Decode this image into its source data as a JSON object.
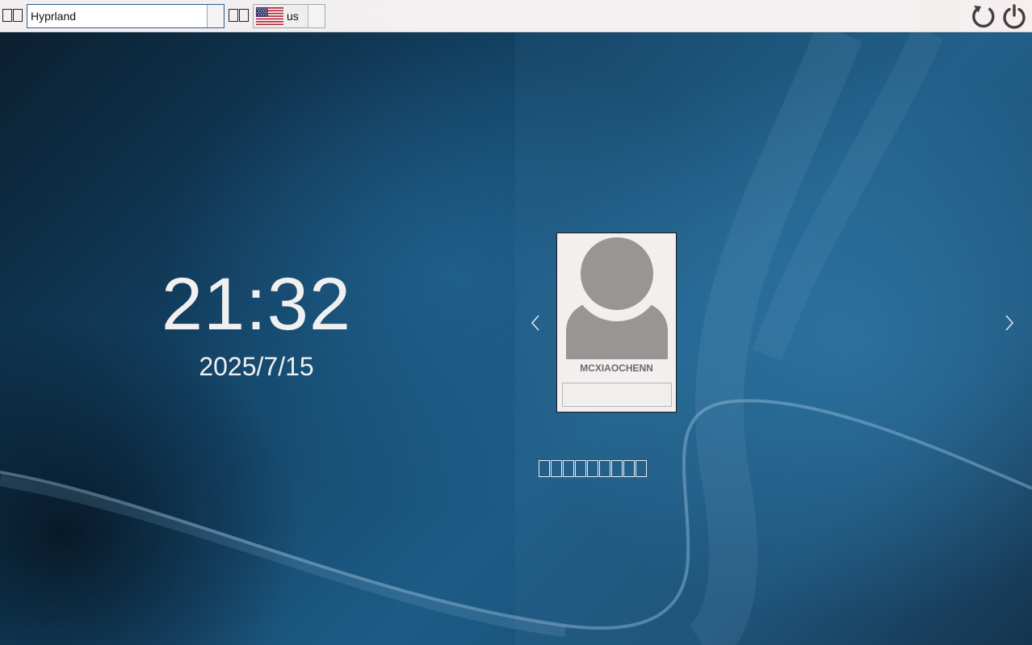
{
  "topbar": {
    "session_label_glyphs": 2,
    "session": {
      "value": "Hyprland"
    },
    "keyboard_label_glyphs": 2,
    "keyboard": {
      "value": "us",
      "flag": "us-flag-icon"
    },
    "reboot_icon": "reboot-icon",
    "shutdown_icon": "power-icon"
  },
  "clock": {
    "time": "21:32",
    "date": "2025/7/15"
  },
  "user": {
    "name": "MCXIAOCHENN",
    "avatar": "user-avatar-icon",
    "password": ""
  },
  "message": {
    "glyph_count": 9
  },
  "colors": {
    "accent": "#2d5c91",
    "card": "#f3efef",
    "avatar": "#999595"
  }
}
